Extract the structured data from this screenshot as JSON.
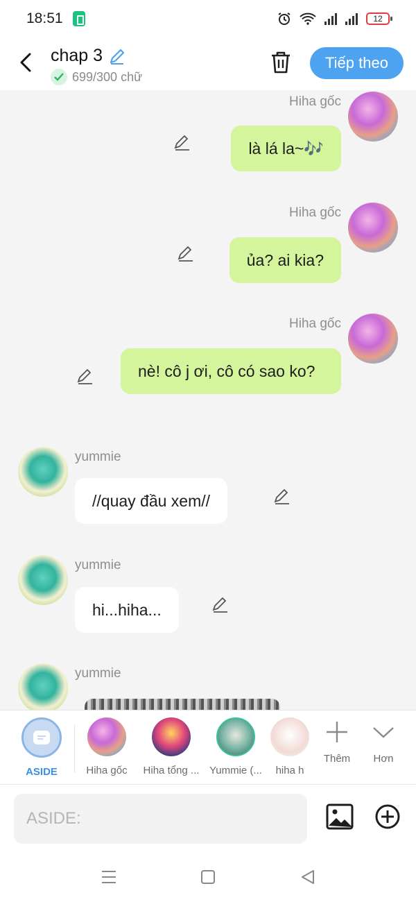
{
  "status": {
    "time": "18:51",
    "battery": "12"
  },
  "header": {
    "title": "chap 3",
    "count": "699/300 chữ",
    "next_label": "Tiếp theo"
  },
  "messages": [
    {
      "sender": "Hiha gốc",
      "text": "là lá la~🎶",
      "side": "right"
    },
    {
      "sender": "Hiha gốc",
      "text": "ủa? ai kia?",
      "side": "right"
    },
    {
      "sender": "Hiha gốc",
      "text": "nè! cô j ơi, cô có sao ko?",
      "side": "right"
    },
    {
      "sender": "yummie",
      "text": "//quay đầu xem//",
      "side": "left"
    },
    {
      "sender": "yummie",
      "text": "hi...hiha...",
      "side": "left"
    },
    {
      "sender": "yummie",
      "text": "",
      "side": "left",
      "type": "image"
    }
  ],
  "characters": [
    {
      "label": "ASIDE"
    },
    {
      "label": "Hiha gốc"
    },
    {
      "label": "Hiha tổng ..."
    },
    {
      "label": "Yummie (..."
    },
    {
      "label": "hiha h"
    }
  ],
  "tools": {
    "more_label": "Thêm",
    "expand_label": "Hơn"
  },
  "input": {
    "placeholder": "ASIDE:"
  },
  "colors": {
    "accent": "#4ea3f1",
    "my_bubble": "#d4f59c",
    "their_bubble": "#ffffff",
    "chat_bg": "#f4f4f4"
  }
}
